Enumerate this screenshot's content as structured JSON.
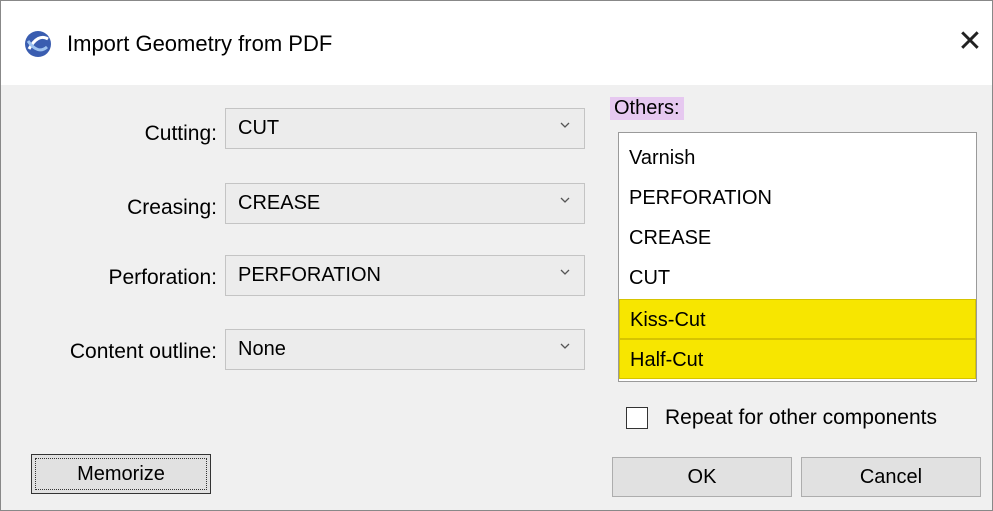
{
  "window": {
    "title": "Import Geometry from PDF"
  },
  "form": {
    "cutting": {
      "label": "Cutting:",
      "value": "CUT"
    },
    "creasing": {
      "label": "Creasing:",
      "value": "CREASE"
    },
    "perforation": {
      "label": "Perforation:",
      "value": "PERFORATION"
    },
    "content_outline": {
      "label": "Content outline:",
      "value": "None"
    }
  },
  "others": {
    "label": "Others:",
    "items": [
      "Varnish",
      "PERFORATION",
      "CREASE",
      "CUT",
      "Kiss-Cut",
      "Half-Cut"
    ],
    "highlighted_color": "#f7e600"
  },
  "repeat": {
    "label": "Repeat for other components",
    "checked": false
  },
  "buttons": {
    "memorize": "Memorize",
    "ok": "OK",
    "cancel": "Cancel"
  }
}
